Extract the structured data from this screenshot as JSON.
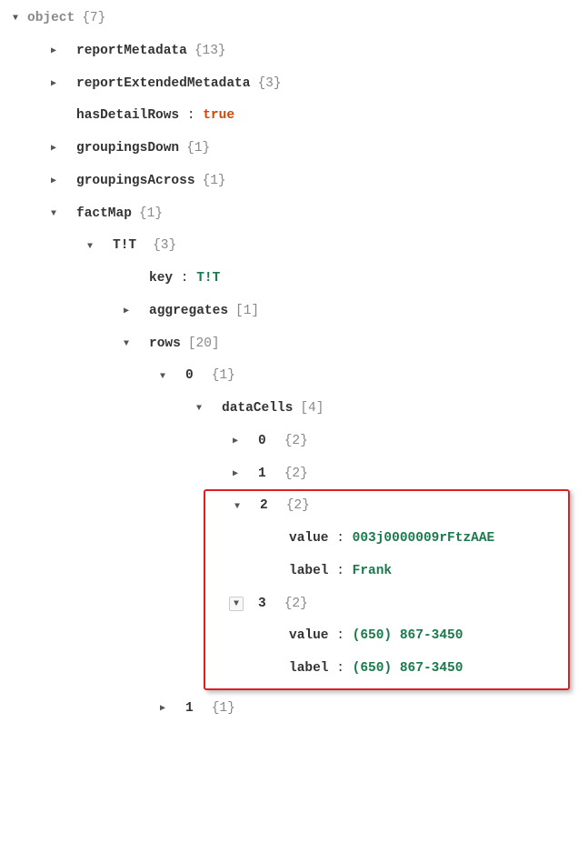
{
  "tree": {
    "root": {
      "label": "object",
      "count": "{7}"
    },
    "reportMetadata": {
      "label": "reportMetadata",
      "count": "{13}"
    },
    "reportExtendedMetadata": {
      "label": "reportExtendedMetadata",
      "count": "{3}"
    },
    "hasDetailRows": {
      "label": "hasDetailRows",
      "value": "true"
    },
    "groupingsDown": {
      "label": "groupingsDown",
      "count": "{1}"
    },
    "groupingsAcross": {
      "label": "groupingsAcross",
      "count": "{1}"
    },
    "factMap": {
      "label": "factMap",
      "count": "{1}",
      "TT": {
        "label": "T!T",
        "count": "{3}",
        "key": {
          "label": "key",
          "value": "T!T"
        },
        "aggregates": {
          "label": "aggregates",
          "count": "[1]"
        },
        "rows": {
          "label": "rows",
          "count": "[20]",
          "row0": {
            "label": "0",
            "count": "{1}",
            "dataCells": {
              "label": "dataCells",
              "count": "[4]",
              "cell0": {
                "label": "0",
                "count": "{2}"
              },
              "cell1": {
                "label": "1",
                "count": "{2}"
              },
              "cell2": {
                "label": "2",
                "count": "{2}",
                "value": {
                  "label": "value",
                  "value": "003j0000009rFtzAAE"
                },
                "labelField": {
                  "label": "label",
                  "value": "Frank"
                }
              },
              "cell3": {
                "label": "3",
                "count": "{2}",
                "value": {
                  "label": "value",
                  "value": "(650) 867-3450"
                },
                "labelField": {
                  "label": "label",
                  "value": "(650) 867-3450"
                }
              }
            }
          },
          "row1": {
            "label": "1",
            "count": "{1}"
          }
        }
      }
    }
  }
}
